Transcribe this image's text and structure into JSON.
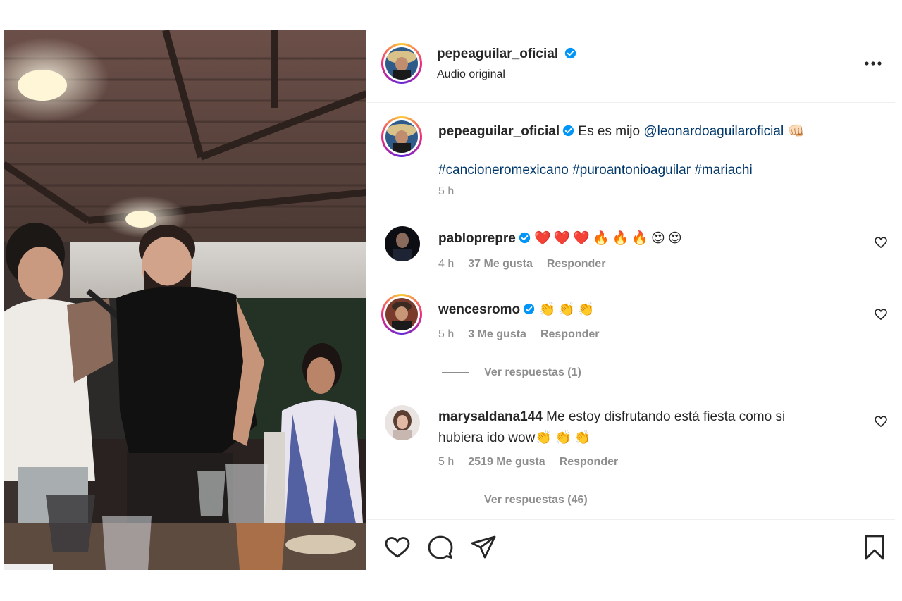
{
  "header": {
    "username": "pepeaguilar_oficial",
    "subtitle": "Audio original",
    "more_icon": "more-horizontal-icon"
  },
  "caption": {
    "username": "pepeaguilar_oficial",
    "text": "Es es mijo",
    "mention": "@leonardoaguilaroficial",
    "emoji": "👊🏻",
    "hashtags": "#cancioneromexicano #puroantonioaguilar #mariachi",
    "time": "5 h"
  },
  "comments": [
    {
      "username": "pabloprepre",
      "verified": true,
      "text": "❤️❤️❤️🔥🔥🔥😍😍",
      "time": "4 h",
      "likes": "37 Me gusta",
      "reply": "Responder"
    },
    {
      "username": "wencesromo",
      "verified": true,
      "text": "👏👏👏",
      "time": "5 h",
      "likes": "3 Me gusta",
      "reply": "Responder",
      "view_replies": "Ver respuestas (1)"
    },
    {
      "username": "marysaldana144",
      "verified": false,
      "text": "Me estoy disfrutando está fiesta como si",
      "text2": "hubiera ido wow",
      "text2_emoji": "👏👏👏",
      "time": "5 h",
      "likes": "2519 Me gusta",
      "reply": "Responder",
      "view_replies": "Ver respuestas (46)"
    }
  ],
  "actions": {
    "like_icon": "heart-icon",
    "comment_icon": "comment-icon",
    "share_icon": "share-icon",
    "save_icon": "bookmark-icon"
  },
  "colors": {
    "verified": "#0095f6",
    "link": "#00376b",
    "muted": "#8e8e8e"
  }
}
